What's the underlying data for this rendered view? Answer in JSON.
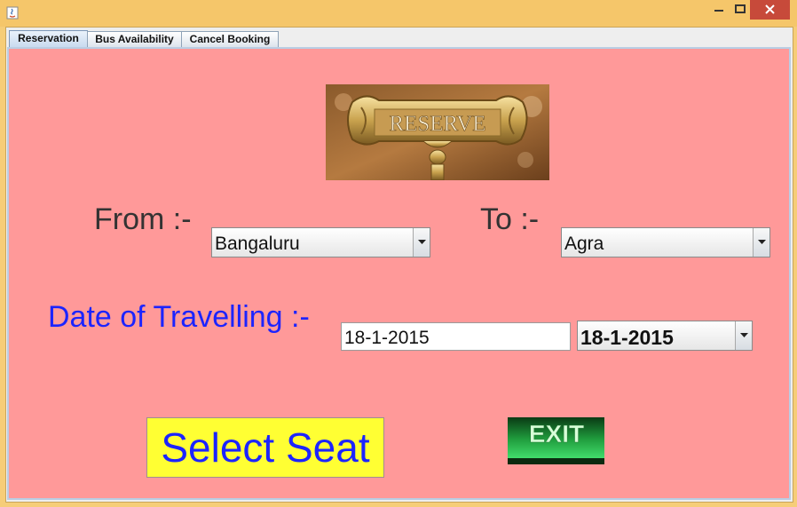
{
  "tabs": [
    {
      "label": "Reservation",
      "active": true
    },
    {
      "label": "Bus Availability",
      "active": false
    },
    {
      "label": "Cancel Booking",
      "active": false
    }
  ],
  "banner": {
    "text": "RESERVE"
  },
  "from": {
    "label": "From :-",
    "selected": "Bangaluru"
  },
  "to": {
    "label": "To :-",
    "selected": "Agra"
  },
  "date": {
    "label": "Date of Travelling :-",
    "field_value": "18-1-2015",
    "picker_value": "18-1-2015"
  },
  "buttons": {
    "select_seat": "Select Seat",
    "exit": "EXIT"
  },
  "colors": {
    "panel_bg": "#ff9999",
    "date_label": "#1c24ff",
    "select_seat_bg": "#ffff33",
    "select_seat_text": "#1c24ff",
    "exit_green": "#2fd35a"
  }
}
